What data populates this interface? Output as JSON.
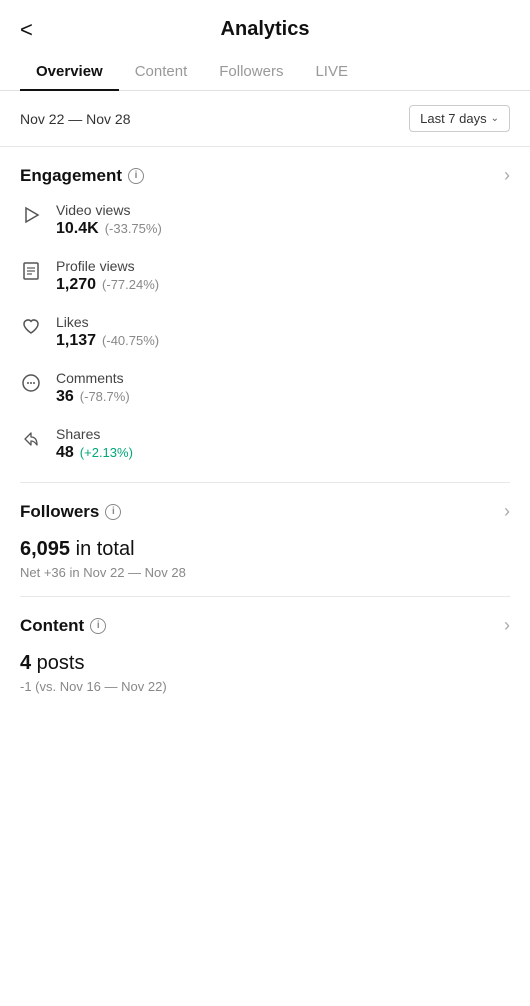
{
  "header": {
    "title": "Analytics",
    "back_label": "<"
  },
  "tabs": [
    {
      "label": "Overview",
      "active": true
    },
    {
      "label": "Content",
      "active": false
    },
    {
      "label": "Followers",
      "active": false
    },
    {
      "label": "LIVE",
      "active": false
    }
  ],
  "date_bar": {
    "range": "Nov 22 — Nov 28",
    "dropdown_label": "Last 7 days"
  },
  "engagement": {
    "section_title": "Engagement",
    "info_icon_label": "i",
    "metrics": [
      {
        "label": "Video views",
        "value": "10.4K",
        "change": "(-33.75%)",
        "positive": false,
        "icon": "play-icon"
      },
      {
        "label": "Profile views",
        "value": "1,270",
        "change": "(-77.24%)",
        "positive": false,
        "icon": "profile-icon"
      },
      {
        "label": "Likes",
        "value": "1,137",
        "change": "(-40.75%)",
        "positive": false,
        "icon": "heart-icon"
      },
      {
        "label": "Comments",
        "value": "36",
        "change": "(-78.7%)",
        "positive": false,
        "icon": "comment-icon"
      },
      {
        "label": "Shares",
        "value": "48",
        "change": "(+2.13%)",
        "positive": true,
        "icon": "share-icon"
      }
    ]
  },
  "followers": {
    "section_title": "Followers",
    "total_value": "6,095",
    "total_label": " in total",
    "net_text": "Net +36 in Nov 22 — Nov 28"
  },
  "content": {
    "section_title": "Content",
    "posts_value": "4",
    "posts_label": " posts",
    "sub_text": "-1 (vs. Nov 16 — Nov 22)"
  }
}
